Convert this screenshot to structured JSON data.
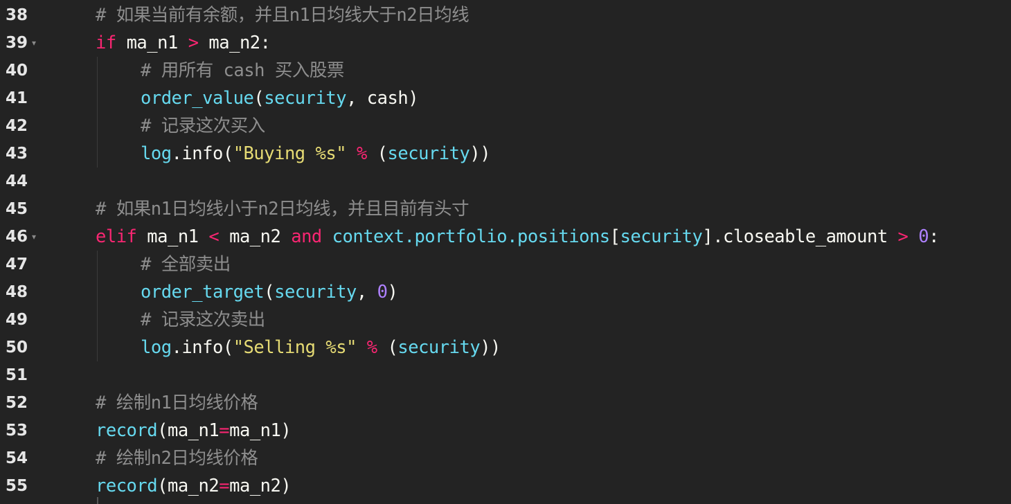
{
  "lines": [
    {
      "num": "38",
      "fold": "",
      "indent": 1,
      "tokens": [
        {
          "t": "# 如果当前有余额，并且n1日均线大于n2日均线",
          "c": "comment"
        }
      ]
    },
    {
      "num": "39",
      "fold": "▾",
      "indent": 1,
      "tokens": [
        {
          "t": "if",
          "c": "kw"
        },
        {
          "t": " ma_n1 ",
          "c": "plain"
        },
        {
          "t": ">",
          "c": "kw"
        },
        {
          "t": " ma_n2:",
          "c": "plain"
        }
      ]
    },
    {
      "num": "40",
      "fold": "",
      "indent": 2,
      "tokens": [
        {
          "t": "# 用所有 cash 买入股票",
          "c": "comment"
        }
      ]
    },
    {
      "num": "41",
      "fold": "",
      "indent": 2,
      "tokens": [
        {
          "t": "order_value",
          "c": "fn"
        },
        {
          "t": "(",
          "c": "plain"
        },
        {
          "t": "security",
          "c": "fn"
        },
        {
          "t": ", cash)",
          "c": "plain"
        }
      ]
    },
    {
      "num": "42",
      "fold": "",
      "indent": 2,
      "tokens": [
        {
          "t": "# 记录这次买入",
          "c": "comment"
        }
      ]
    },
    {
      "num": "43",
      "fold": "",
      "indent": 2,
      "tokens": [
        {
          "t": "log",
          "c": "fn"
        },
        {
          "t": ".info(",
          "c": "plain"
        },
        {
          "t": "\"Buying %s\"",
          "c": "str"
        },
        {
          "t": " ",
          "c": "plain"
        },
        {
          "t": "%",
          "c": "kw"
        },
        {
          "t": " (",
          "c": "plain"
        },
        {
          "t": "security",
          "c": "fn"
        },
        {
          "t": "))",
          "c": "plain"
        }
      ]
    },
    {
      "num": "44",
      "fold": "",
      "indent": 1,
      "tokens": []
    },
    {
      "num": "45",
      "fold": "",
      "indent": 1,
      "tokens": [
        {
          "t": "# 如果n1日均线小于n2日均线，并且目前有头寸",
          "c": "comment"
        }
      ]
    },
    {
      "num": "46",
      "fold": "▾",
      "indent": 1,
      "tokens": [
        {
          "t": "elif",
          "c": "kw"
        },
        {
          "t": " ma_n1 ",
          "c": "plain"
        },
        {
          "t": "<",
          "c": "kw"
        },
        {
          "t": " ma_n2 ",
          "c": "plain"
        },
        {
          "t": "and",
          "c": "kw"
        },
        {
          "t": " ",
          "c": "plain"
        },
        {
          "t": "context.portfolio.positions",
          "c": "fn"
        },
        {
          "t": "[",
          "c": "plain"
        },
        {
          "t": "security",
          "c": "fn"
        },
        {
          "t": "].closeable_amount ",
          "c": "plain"
        },
        {
          "t": ">",
          "c": "kw"
        },
        {
          "t": " ",
          "c": "plain"
        },
        {
          "t": "0",
          "c": "num"
        },
        {
          "t": ":",
          "c": "plain"
        }
      ]
    },
    {
      "num": "47",
      "fold": "",
      "indent": 2,
      "tokens": [
        {
          "t": "# 全部卖出",
          "c": "comment"
        }
      ]
    },
    {
      "num": "48",
      "fold": "",
      "indent": 2,
      "tokens": [
        {
          "t": "order_target",
          "c": "fn"
        },
        {
          "t": "(",
          "c": "plain"
        },
        {
          "t": "security",
          "c": "fn"
        },
        {
          "t": ", ",
          "c": "plain"
        },
        {
          "t": "0",
          "c": "num"
        },
        {
          "t": ")",
          "c": "plain"
        }
      ]
    },
    {
      "num": "49",
      "fold": "",
      "indent": 2,
      "tokens": [
        {
          "t": "# 记录这次卖出",
          "c": "comment"
        }
      ]
    },
    {
      "num": "50",
      "fold": "",
      "indent": 2,
      "tokens": [
        {
          "t": "log",
          "c": "fn"
        },
        {
          "t": ".info(",
          "c": "plain"
        },
        {
          "t": "\"Selling %s\"",
          "c": "str"
        },
        {
          "t": " ",
          "c": "plain"
        },
        {
          "t": "%",
          "c": "kw"
        },
        {
          "t": " (",
          "c": "plain"
        },
        {
          "t": "security",
          "c": "fn"
        },
        {
          "t": "))",
          "c": "plain"
        }
      ]
    },
    {
      "num": "51",
      "fold": "",
      "indent": 1,
      "tokens": []
    },
    {
      "num": "52",
      "fold": "",
      "indent": 1,
      "tokens": [
        {
          "t": "# 绘制n1日均线价格",
          "c": "comment"
        }
      ]
    },
    {
      "num": "53",
      "fold": "",
      "indent": 1,
      "tokens": [
        {
          "t": "record",
          "c": "fn"
        },
        {
          "t": "(ma_n1",
          "c": "plain"
        },
        {
          "t": "=",
          "c": "kw"
        },
        {
          "t": "ma_n1)",
          "c": "plain"
        }
      ]
    },
    {
      "num": "54",
      "fold": "",
      "indent": 1,
      "tokens": [
        {
          "t": "# 绘制n2日均线价格",
          "c": "comment"
        }
      ]
    },
    {
      "num": "55",
      "fold": "",
      "indent": 1,
      "tokens": [
        {
          "t": "record",
          "c": "fn"
        },
        {
          "t": "(ma_n2",
          "c": "plain"
        },
        {
          "t": "=",
          "c": "kw"
        },
        {
          "t": "ma_n2)",
          "c": "plain"
        }
      ]
    }
  ],
  "colors": {
    "background": "#232323",
    "comment": "#8e8e8e",
    "keyword": "#f92672",
    "function": "#66d9ef",
    "string": "#e6db74",
    "number": "#ae81ff",
    "text": "#f8f8f2",
    "line_number": "#e6e6e6"
  }
}
